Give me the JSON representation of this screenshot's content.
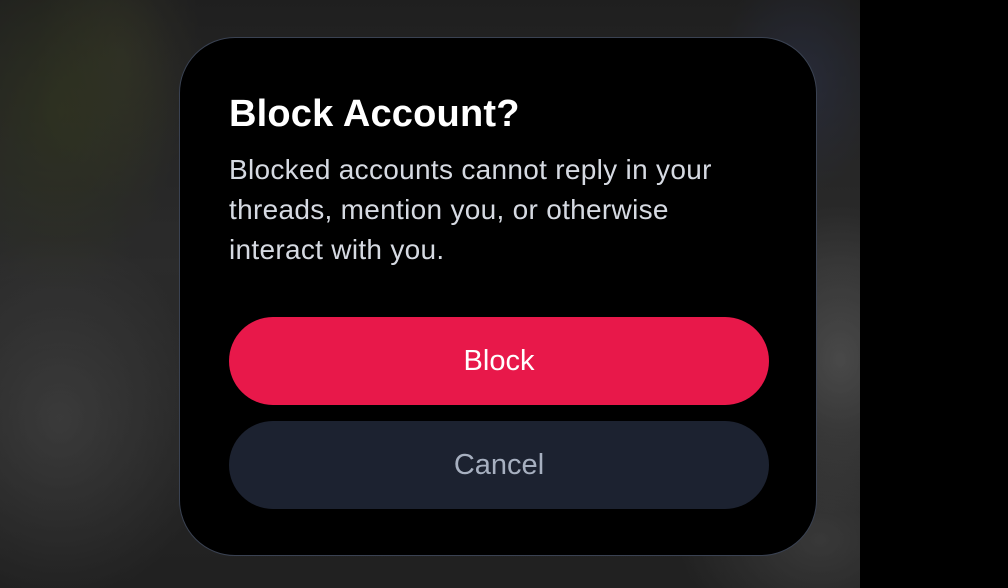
{
  "dialog": {
    "title": "Block Account?",
    "message": "Blocked accounts cannot reply in your threads, mention you, or otherwise interact with you.",
    "confirm_label": "Block",
    "cancel_label": "Cancel"
  },
  "colors": {
    "danger_accent": "#e8184a",
    "secondary_button": "#1c2230",
    "dialog_background": "#000000",
    "dialog_border": "#3a4252",
    "title_text": "#ffffff",
    "body_text": "#d6dae2",
    "cancel_text": "#a7b0c0"
  }
}
